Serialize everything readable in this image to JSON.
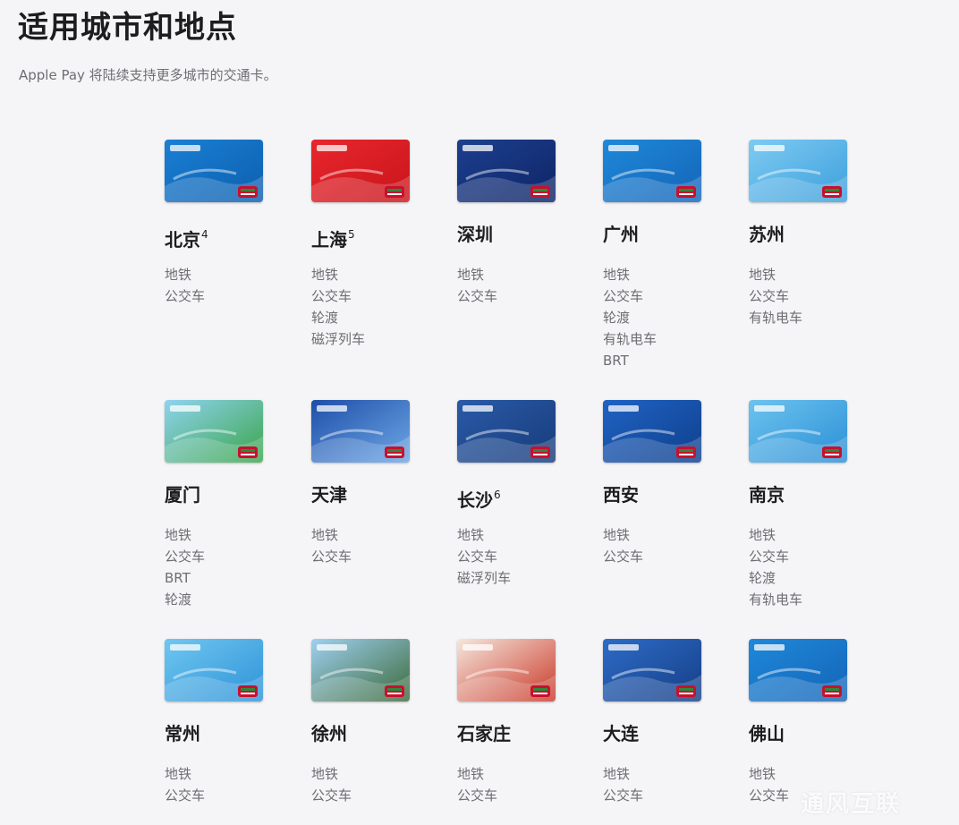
{
  "header": {
    "title": "适用城市和地点",
    "subtitle": "Apple Pay 将陆续支持更多城市的交通卡。"
  },
  "cities": [
    {
      "name": "北京",
      "note": "4",
      "modes": [
        "地铁",
        "公交车"
      ],
      "card_colors": [
        "#1a7fd4",
        "#0d5fae"
      ],
      "card_icon": "beijing-card-icon"
    },
    {
      "name": "上海",
      "note": "5",
      "modes": [
        "地铁",
        "公交车",
        "轮渡",
        "磁浮列车"
      ],
      "card_colors": [
        "#e8262d",
        "#c9151b"
      ],
      "card_icon": "shanghai-card-icon"
    },
    {
      "name": "深圳",
      "note": "",
      "modes": [
        "地铁",
        "公交车"
      ],
      "card_colors": [
        "#1c3f8f",
        "#0f2566"
      ],
      "card_icon": "shenzhen-card-icon"
    },
    {
      "name": "广州",
      "note": "",
      "modes": [
        "地铁",
        "公交车",
        "轮渡",
        "有轨电车",
        "BRT"
      ],
      "card_colors": [
        "#1e88d9",
        "#1565b8"
      ],
      "card_icon": "guangzhou-card-icon"
    },
    {
      "name": "苏州",
      "note": "",
      "modes": [
        "地铁",
        "公交车",
        "有轨电车"
      ],
      "card_colors": [
        "#7ecbf2",
        "#3d9fdc"
      ],
      "card_icon": "suzhou-card-icon"
    },
    {
      "name": "厦门",
      "note": "",
      "modes": [
        "地铁",
        "公交车",
        "BRT",
        "轮渡"
      ],
      "card_colors": [
        "#8fd3f0",
        "#3aa54a"
      ],
      "card_icon": "xiamen-card-icon"
    },
    {
      "name": "天津",
      "note": "",
      "modes": [
        "地铁",
        "公交车"
      ],
      "card_colors": [
        "#1e4fa8",
        "#6fa8e6"
      ],
      "card_icon": "tianjin-card-icon"
    },
    {
      "name": "长沙",
      "note": "6",
      "modes": [
        "地铁",
        "公交车",
        "磁浮列车"
      ],
      "card_colors": [
        "#2a5aa8",
        "#173c7a"
      ],
      "card_icon": "changsha-card-icon"
    },
    {
      "name": "西安",
      "note": "",
      "modes": [
        "地铁",
        "公交车"
      ],
      "card_colors": [
        "#1f63c4",
        "#0f3f8c"
      ],
      "card_icon": "xian-card-icon"
    },
    {
      "name": "南京",
      "note": "",
      "modes": [
        "地铁",
        "公交车",
        "轮渡",
        "有轨电车"
      ],
      "card_colors": [
        "#6cc3ee",
        "#2c8fd6"
      ],
      "card_icon": "nanjing-card-icon"
    },
    {
      "name": "常州",
      "note": "",
      "modes": [
        "地铁",
        "公交车"
      ],
      "card_colors": [
        "#6fc6f0",
        "#2f93d8"
      ],
      "card_icon": "changzhou-card-icon"
    },
    {
      "name": "徐州",
      "note": "",
      "modes": [
        "地铁",
        "公交车"
      ],
      "card_colors": [
        "#9fd0f0",
        "#3b6a3a"
      ],
      "card_icon": "xuzhou-card-icon"
    },
    {
      "name": "石家庄",
      "note": "",
      "modes": [
        "地铁",
        "公交车"
      ],
      "card_colors": [
        "#f6e6dc",
        "#c93a2a"
      ],
      "card_icon": "shijiazhuang-card-icon"
    },
    {
      "name": "大连",
      "note": "",
      "modes": [
        "地铁",
        "公交车"
      ],
      "card_colors": [
        "#2d6cc7",
        "#163e86"
      ],
      "card_icon": "dalian-card-icon"
    },
    {
      "name": "佛山",
      "note": "",
      "modes": [
        "地铁",
        "公交车"
      ],
      "card_colors": [
        "#1e88d9",
        "#1565b8"
      ],
      "card_icon": "foshan-card-icon"
    }
  ],
  "watermark": "通风互联"
}
